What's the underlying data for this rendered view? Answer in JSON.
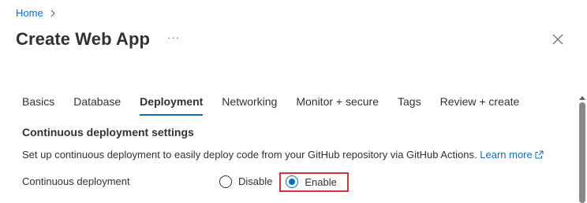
{
  "breadcrumb": {
    "home_label": "Home"
  },
  "header": {
    "title": "Create Web App",
    "more_label": "···"
  },
  "tabs": [
    {
      "label": "Basics",
      "active": false
    },
    {
      "label": "Database",
      "active": false
    },
    {
      "label": "Deployment",
      "active": true
    },
    {
      "label": "Networking",
      "active": false
    },
    {
      "label": "Monitor + secure",
      "active": false
    },
    {
      "label": "Tags",
      "active": false
    },
    {
      "label": "Review + create",
      "active": false
    }
  ],
  "section": {
    "title": "Continuous deployment settings",
    "description": "Set up continuous deployment to easily deploy code from your GitHub repository via GitHub Actions.",
    "learn_more": "Learn more"
  },
  "field": {
    "label": "Continuous deployment",
    "options": [
      {
        "label": "Disable",
        "selected": false
      },
      {
        "label": "Enable",
        "selected": true
      }
    ]
  },
  "colors": {
    "accent": "#0f6cbd",
    "highlight": "#d13438",
    "text": "#323130"
  },
  "icons": {
    "breadcrumb_separator": "chevron-right-icon",
    "close": "close-icon",
    "external_link": "external-link-icon",
    "scroll_up": "scroll-up-arrow-icon"
  }
}
